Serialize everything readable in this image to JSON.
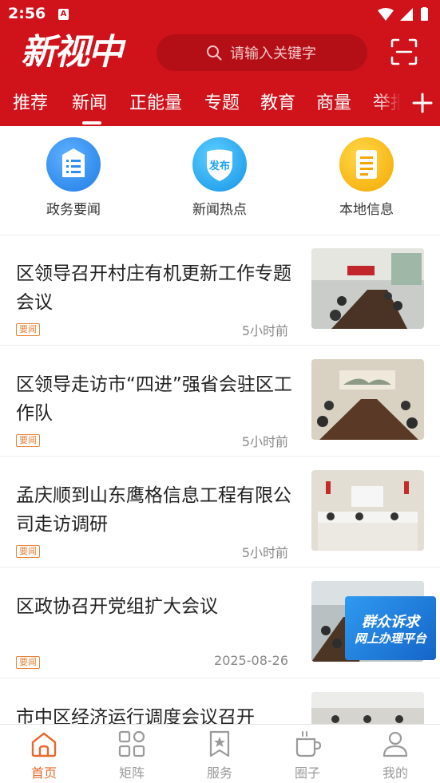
{
  "status_bar": {
    "time": "2:56",
    "app_badge": "A"
  },
  "header": {
    "logo_text": "新视中",
    "search_placeholder": "请输入关键字",
    "accent_color": "#d0121b"
  },
  "tabs": [
    "推荐",
    "新闻",
    "正能量",
    "专题",
    "教育",
    "商量",
    "举报"
  ],
  "selected_tab": "新闻",
  "quick_links": [
    {
      "label": "政务要闻",
      "icon": "document-list-icon",
      "color": "#2d8cf0"
    },
    {
      "label": "新闻热点",
      "icon": "publish-shield-icon",
      "color": "#1aa3f0",
      "badge": "发布"
    },
    {
      "label": "本地信息",
      "icon": "note-icon",
      "color": "#f7b500"
    }
  ],
  "news": [
    {
      "title": "区领导召开村庄有机更新工作专题会议",
      "tag": "要闻",
      "time": "5小时前"
    },
    {
      "title": "区领导走访市“四进”强省会驻区工作队",
      "tag": "要闻",
      "time": "5小时前"
    },
    {
      "title": "孟庆顺到山东鹰格信息工程有限公司走访调研",
      "tag": "要闻",
      "time": "5小时前"
    },
    {
      "title": "区政协召开党组扩大会议",
      "tag": "要闻",
      "time": "2025-08-26"
    },
    {
      "title": "市中区经济运行调度会议召开",
      "tag": "",
      "time": ""
    }
  ],
  "float_banner": {
    "line1": "群众诉求",
    "line2": "网上办理平台"
  },
  "bottom_nav": [
    {
      "label": "首页",
      "icon": "home-icon",
      "active": true
    },
    {
      "label": "矩阵",
      "icon": "grid-icon",
      "active": false
    },
    {
      "label": "服务",
      "icon": "bookmark-star-icon",
      "active": false
    },
    {
      "label": "圈子",
      "icon": "cup-icon",
      "active": false
    },
    {
      "label": "我的",
      "icon": "user-icon",
      "active": false
    }
  ]
}
